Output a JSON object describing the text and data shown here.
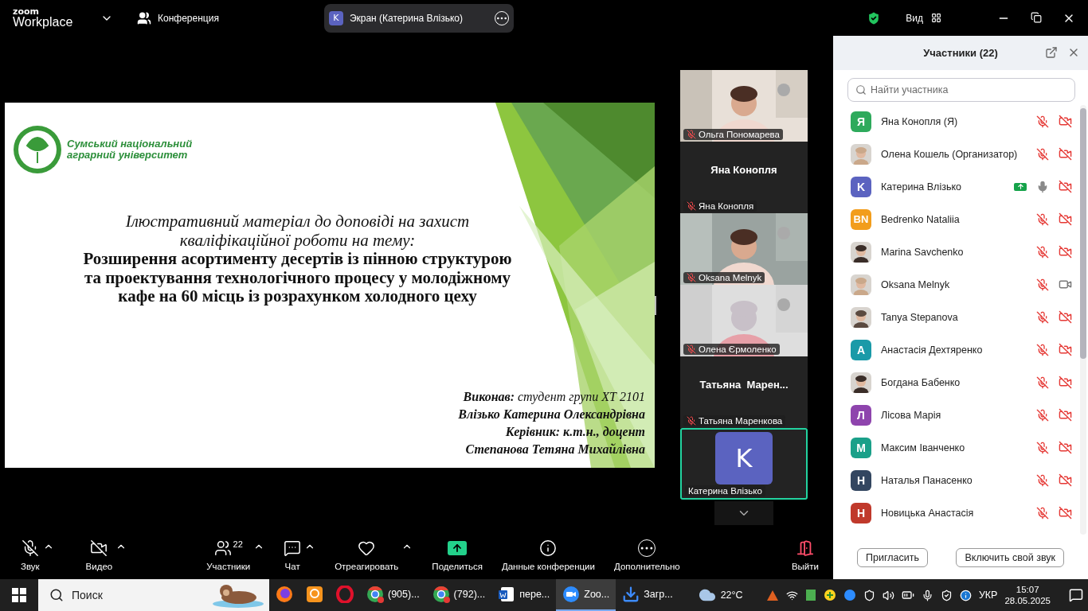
{
  "app_bar": {
    "logo_top": "zoom",
    "logo_bottom": "Workplace",
    "meeting_label": "Конференция",
    "share_pill": {
      "initial": "K",
      "label": "Экран (Катерина Влізько)"
    },
    "view_label": "Вид"
  },
  "slide": {
    "university": [
      "Сумський національний",
      "аграрний університет"
    ],
    "title_italic": [
      "Ілюстративний матеріал до доповіді на захист",
      "кваліфікаційної роботи на тему:"
    ],
    "title_bold": [
      "Розширення асортименту десертів із пінною структурою",
      "та проектування технологічного процесу у молодіжному",
      "кафе на 60 місць із розрахунком холодного цеху"
    ],
    "author_lines": [
      {
        "text": "**Виконав:** студент групи ХТ 2101",
        "bold": false
      },
      {
        "text": "Влізько Катерина Олександрівна",
        "bold": true
      },
      {
        "text": "Керівник: к.т.н., доцент",
        "bold": true
      },
      {
        "text": "Степанова Тетяна Михайлівна",
        "bold": true
      }
    ]
  },
  "video_tiles": [
    {
      "kind": "video",
      "label": "Ольга Пономарева",
      "muted": true,
      "active_speaker": false
    },
    {
      "kind": "name",
      "title": "Яна Конопля",
      "label": "Яна Конопля",
      "muted": true,
      "active_speaker": false
    },
    {
      "kind": "video",
      "label": "Oksana Melnyk",
      "muted": true,
      "active_speaker": false
    },
    {
      "kind": "video",
      "label": "Олена Єрмоленко",
      "muted": true,
      "active_speaker": false
    },
    {
      "kind": "name",
      "title": "Татьяна  Марен...",
      "label": "Татьяна Маренкова",
      "muted": true,
      "active_speaker": false
    },
    {
      "kind": "avatar",
      "initial": "K",
      "label": "Катерина Влізько",
      "muted": false,
      "active_speaker": true
    }
  ],
  "toolbar": [
    {
      "kind": "audio",
      "label": "Звук",
      "off": true,
      "caret": true
    },
    {
      "kind": "video",
      "label": "Видео",
      "off": true,
      "caret": true
    },
    {
      "kind": "participants",
      "label": "Участники",
      "count": "22",
      "caret": true
    },
    {
      "kind": "chat",
      "label": "Чат",
      "caret": true
    },
    {
      "kind": "react",
      "label": "Отреагировать",
      "caret": true
    },
    {
      "kind": "share",
      "label": "Поделиться",
      "caret": false
    },
    {
      "kind": "info",
      "label": "Данные конференции",
      "caret": false
    },
    {
      "kind": "more",
      "label": "Дополнительно",
      "caret": false
    }
  ],
  "leave_button": {
    "label": "Выйти"
  },
  "participants_panel": {
    "title": "Участники (22)",
    "search": {
      "placeholder": "Найти участника"
    },
    "participants": [
      {
        "name": "Яна Конопля (Я)",
        "avatar": {
          "kind": "letter",
          "text": "Я",
          "color": "#2eaa5c"
        },
        "sharing": false,
        "mic_muted": true,
        "video_off": true
      },
      {
        "name": "Олена Кошель (Организатор)",
        "sharing": false,
        "mic_muted": true,
        "video_off": true
      },
      {
        "name": "Катерина Влізько",
        "avatar": {
          "kind": "letter",
          "text": "K",
          "color": "#5b63c0"
        },
        "sharing": true,
        "mic_muted": false,
        "video_off": true
      },
      {
        "name": "Bedrenko Nataliia",
        "avatar": {
          "kind": "letter",
          "text": "BN",
          "color": "#f29d1c"
        },
        "sharing": false,
        "mic_muted": true,
        "video_off": true
      },
      {
        "name": "Marina Savchenko",
        "sharing": false,
        "mic_muted": true,
        "video_off": true
      },
      {
        "name": "Oksana Melnyk",
        "sharing": false,
        "mic_muted": true,
        "video_off": false
      },
      {
        "name": "Tanya Stepanova",
        "sharing": false,
        "mic_muted": true,
        "video_off": true
      },
      {
        "name": "Анастасія Дехтяренко",
        "avatar": {
          "kind": "letter",
          "text": "А",
          "color": "#1a9aa8"
        },
        "sharing": false,
        "mic_muted": true,
        "video_off": true
      },
      {
        "name": "Богдана Бабенко",
        "sharing": false,
        "mic_muted": true,
        "video_off": true
      },
      {
        "name": "Лісова Марія",
        "avatar": {
          "kind": "letter",
          "text": "Л",
          "color": "#8e44ad"
        },
        "sharing": false,
        "mic_muted": true,
        "video_off": true
      },
      {
        "name": "Максим Іванченко",
        "avatar": {
          "kind": "letter",
          "text": "М",
          "color": "#1aa089"
        },
        "sharing": false,
        "mic_muted": true,
        "video_off": true
      },
      {
        "name": "Наталья Панасенко",
        "avatar": {
          "kind": "letter",
          "text": "Н",
          "color": "#334660"
        },
        "sharing": false,
        "mic_muted": true,
        "video_off": true
      },
      {
        "name": "Новицька Анастасія",
        "avatar": {
          "kind": "letter",
          "text": "Н",
          "color": "#c0392b"
        },
        "sharing": false,
        "mic_muted": true,
        "video_off": true
      }
    ],
    "buttons": [
      "Пригласить",
      "Включить свой звук"
    ]
  },
  "taskbar": {
    "search_placeholder": "Поиск",
    "apps": [
      {
        "kind": "firefox",
        "selected": false
      },
      {
        "kind": "pdf",
        "selected": false
      },
      {
        "kind": "opera",
        "selected": false
      },
      {
        "kind": "chrome",
        "label": "(905)...",
        "selected": false
      },
      {
        "kind": "chrome",
        "label": "(792)...",
        "selected": false
      },
      {
        "kind": "word",
        "label": "пере...",
        "selected": false
      },
      {
        "kind": "zoom",
        "label": "Zoo...",
        "selected": true
      },
      {
        "kind": "download",
        "label": "Загр...",
        "selected": false
      }
    ],
    "weather": "22°C",
    "language": "УКР",
    "time": "15:07",
    "date": "28.05.2025"
  }
}
